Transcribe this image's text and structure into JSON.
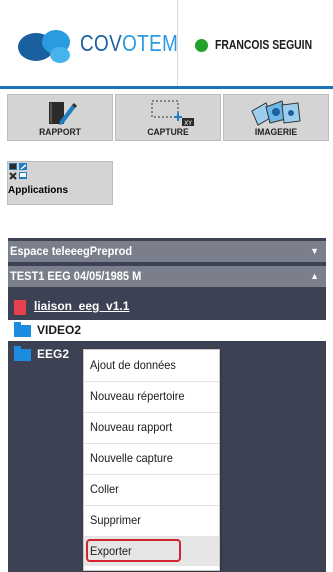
{
  "header": {
    "brand": {
      "part1": "COV",
      "part2": "OTEM"
    },
    "user_name": "FRANCOIS SEGUIN",
    "status_color": "#21a02a"
  },
  "toolbar": {
    "buttons": [
      {
        "label": "RAPPORT",
        "icon": "report-pencil-icon"
      },
      {
        "label": "CAPTURE",
        "icon": "capture-selection-icon"
      },
      {
        "label": "IMAGERIE",
        "icon": "imaging-icon"
      }
    ],
    "apps": {
      "label": "Applications",
      "icon": "apps-grid-icon"
    }
  },
  "workspace": {
    "title": "Espace teleeegPreprod",
    "arrow": "▼"
  },
  "patient": {
    "title": "TEST1 EEG 04/05/1985 M",
    "arrow": "▲"
  },
  "tree": {
    "file": "liaison_eeg_v1.1",
    "folders": [
      "VIDEO2",
      "EEG2"
    ]
  },
  "context_menu": {
    "items": [
      "Ajout de données",
      "Nouveau répertoire",
      "Nouveau rapport",
      "Nouvelle capture",
      "Coller",
      "Supprimer",
      "Exporter"
    ],
    "highlighted": "Exporter"
  }
}
